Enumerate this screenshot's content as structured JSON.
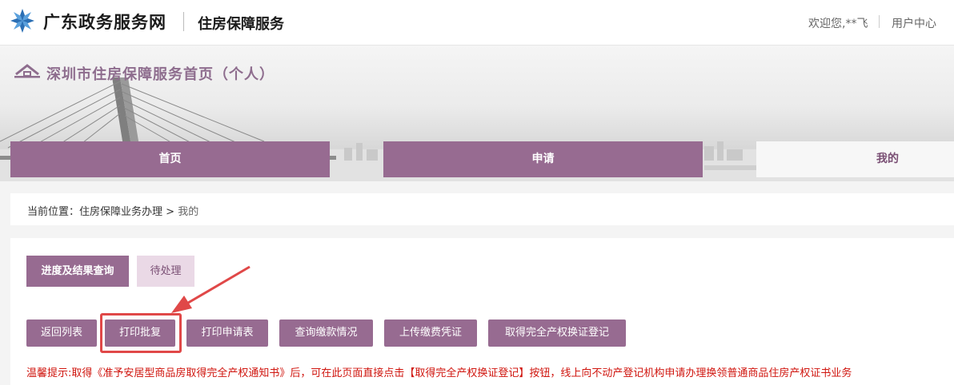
{
  "header": {
    "brand": "广东政务服务网",
    "subbrand": "住房保障服务",
    "welcome": "欢迎您,**飞",
    "user_center": "用户中心"
  },
  "banner": {
    "title": "深圳市住房保障服务首页（个人）"
  },
  "nav": {
    "tabs": [
      {
        "label": "首页"
      },
      {
        "label": "申请"
      },
      {
        "label": "我的"
      }
    ]
  },
  "breadcrumb": {
    "prefix": "当前位置：住房保障业务办理",
    "separator": ">",
    "current": "我的"
  },
  "subtabs": {
    "items": [
      {
        "label": "进度及结果查询"
      },
      {
        "label": "待处理"
      }
    ]
  },
  "actions": {
    "buttons": [
      {
        "label": "返回列表"
      },
      {
        "label": "打印批复"
      },
      {
        "label": "打印申请表"
      },
      {
        "label": "查询缴款情况"
      },
      {
        "label": "上传缴费凭证"
      },
      {
        "label": "取得完全产权换证登记"
      }
    ]
  },
  "tip": {
    "text": "温馨提示:取得《准予安居型商品房取得完全产权通知书》后，可在此页面直接点击【取得完全产权换证登记】按钮，线上向不动产登记机构申请办理换领普通商品住房产权证书业务"
  },
  "colors": {
    "primary": "#976b91",
    "highlight": "#e04848",
    "tip": "#d0160f"
  }
}
